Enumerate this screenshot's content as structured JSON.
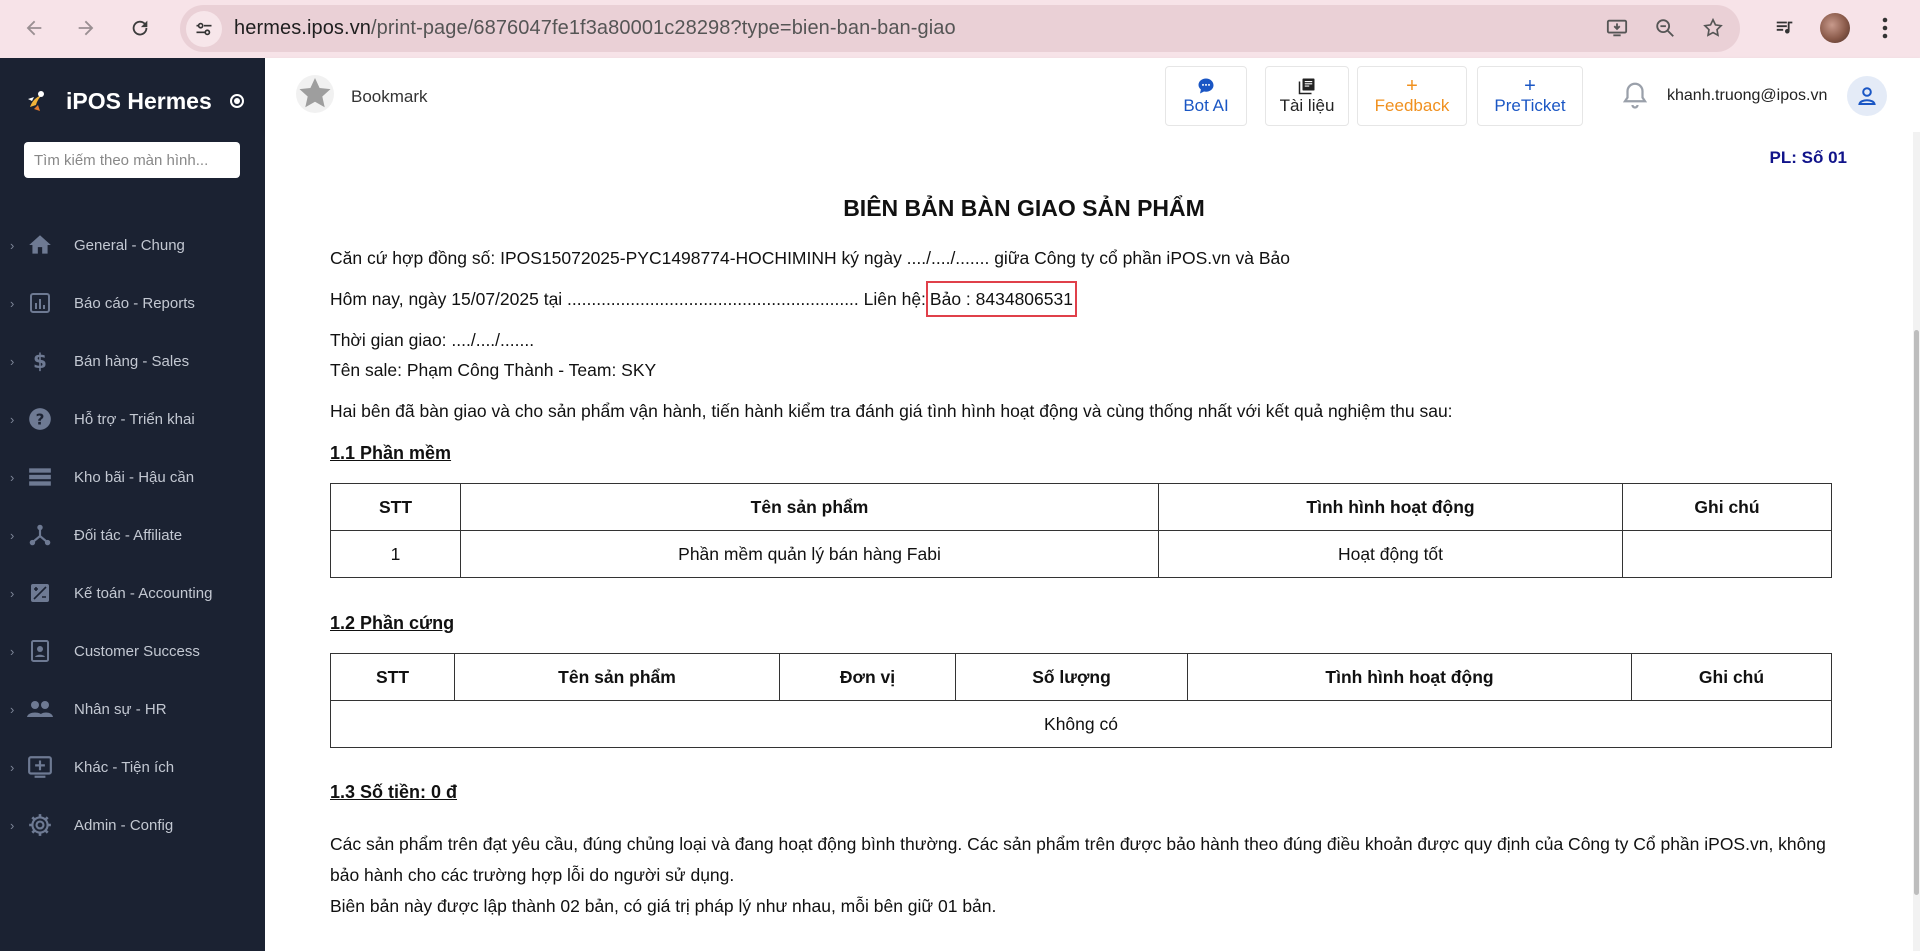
{
  "browser": {
    "url_host": "hermes.ipos.vn",
    "url_path": "/print-page/6876047fe1f3a80001c28298?type=bien-ban-ban-giao"
  },
  "sidebar": {
    "brand": "iPOS Hermes",
    "search_placeholder": "Tìm kiếm theo màn hình...",
    "items": [
      {
        "label": "General - Chung",
        "icon": "home-icon"
      },
      {
        "label": "Báo cáo - Reports",
        "icon": "bar-chart-icon"
      },
      {
        "label": "Bán hàng - Sales",
        "icon": "dollar-icon"
      },
      {
        "label": "Hỗ trợ - Triển khai",
        "icon": "help-icon"
      },
      {
        "label": "Kho bãi - Hậu cần",
        "icon": "storage-icon"
      },
      {
        "label": "Đối tác - Affiliate",
        "icon": "network-icon"
      },
      {
        "label": "Kế toán - Accounting",
        "icon": "calculator-icon"
      },
      {
        "label": "Customer Success",
        "icon": "contact-icon"
      },
      {
        "label": "Nhân sự - HR",
        "icon": "people-icon"
      },
      {
        "label": "Khác - Tiện ích",
        "icon": "add-box-icon"
      },
      {
        "label": "Admin - Config",
        "icon": "gear-icon"
      }
    ]
  },
  "header": {
    "bookmark": "Bookmark",
    "bot_ai": "Bot AI",
    "tai_lieu": "Tài liệu",
    "feedback": "Feedback",
    "preticket": "PreTicket",
    "plus": "+",
    "user_email": "khanh.truong@ipos.vn"
  },
  "colors": {
    "sidebar_bg": "#1b2232",
    "feedback": "#f0901e",
    "primary": "#1a56c4",
    "pl_label": "#10138a",
    "highlight_border": "#e0404a"
  },
  "document": {
    "pl": "PL: Số 01",
    "title": "BIÊN BẢN BÀN GIAO SẢN PHẨM",
    "contract_line": "Căn cứ hợp đồng số: IPOS15072025-PYC1498774-HOCHIMINH ký ngày ..../..../....... giữa Công ty cổ phần iPOS.vn và Bảo",
    "date_line": "Hôm nay, ngày 15/07/2025 tại ............................................................ Liên hệ:",
    "contact": "Bảo : 8434806531",
    "delivery_time": "Thời gian giao: ..../..../.......",
    "sale_name": "Tên sale: Phạm Công Thành - Team: SKY",
    "intro": "Hai bên đã bàn giao và cho sản phẩm vận hành, tiến hành kiểm tra đánh giá tình hình hoạt động và cùng thống nhất với kết quả nghiệm thu sau:",
    "software": {
      "heading": "1.1 Phần mềm",
      "headers": [
        "STT",
        "Tên sản phẩm",
        "Tình hình hoạt động",
        "Ghi chú"
      ],
      "rows": [
        [
          "1",
          "Phần mềm quản lý bán hàng Fabi",
          "Hoạt động tốt",
          ""
        ]
      ]
    },
    "hardware": {
      "heading": "1.2 Phần cứng",
      "headers": [
        "STT",
        "Tên sản phẩm",
        "Đơn vị",
        "Số lượng",
        "Tình hình hoạt động",
        "Ghi chú"
      ],
      "empty": "Không có"
    },
    "amount_heading": "1.3 Số tiền: 0 đ",
    "closing_1": "Các sản phẩm trên đạt yêu cầu, đúng chủng loại và đang hoạt động bình thường. Các sản phẩm trên được bảo hành theo đúng điều khoản được quy định của Công ty Cổ phần iPOS.vn, không bảo hành cho các trường hợp lỗi do người sử dụng.",
    "closing_2": "Biên bản này được lập thành 02 bản, có giá trị pháp lý như nhau, mỗi bên giữ 01 bản."
  }
}
